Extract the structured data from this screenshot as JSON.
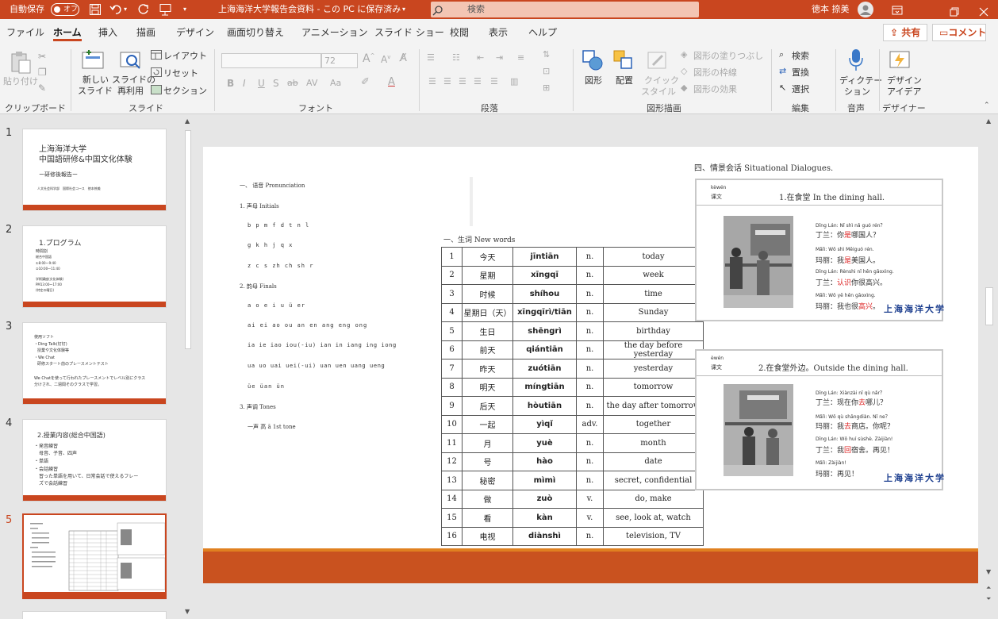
{
  "titlebar": {
    "autosave_label": "自動保存",
    "autosave_state": "オフ",
    "doc_title": "上海海洋大学報告会資料 - この PC に保存済み",
    "search_placeholder": "検索",
    "user_name": "徳本 捺美"
  },
  "tabs": [
    "ファイル",
    "ホーム",
    "挿入",
    "描画",
    "デザイン",
    "画面切り替え",
    "アニメーション",
    "スライド ショー",
    "校閲",
    "表示",
    "ヘルプ"
  ],
  "share_label": "共有",
  "comment_label": "コメント",
  "ribbon": {
    "paste": "貼り付け",
    "clipboard": "クリップボード",
    "new_slide_1": "新しい",
    "new_slide_2": "スライド",
    "reuse_1": "スライドの",
    "reuse_2": "再利用",
    "layout": "レイアウト",
    "reset": "リセット",
    "section": "セクション",
    "slides_group": "スライド",
    "font_size": "72",
    "font_group": "フォント",
    "paragraph_group": "段落",
    "shape": "図形",
    "arrange": "配置",
    "quick_1": "クイック",
    "quick_2": "スタイル",
    "fill": "図形の塗りつぶし",
    "outline": "図形の枠線",
    "effect": "図形の効果",
    "drawing_group": "図形描画",
    "find": "検索",
    "replace": "置換",
    "select": "選択",
    "editing_group": "編集",
    "dictate_1": "ディクテー",
    "dictate_2": "ション",
    "voice_group": "音声",
    "designer_1": "デザイン",
    "designer_2": "アイデア",
    "designer_group": "デザイナー"
  },
  "thumbnails": [
    {
      "num": "1",
      "title1": "上海海洋大学",
      "title2": "中国語研修&中国文化体験",
      "sub": "ー研修後報告ー",
      "foot": "人文社会科学部　国際社会コース　徳本捺美"
    },
    {
      "num": "2",
      "title": "1.プログラム",
      "l1": "時間割",
      "l2": "総合中国語",
      "l3": "①8:00〜9:40",
      "l4": "②10:00〜11:40",
      "l5": "学術講座(文化体験)",
      "l6": "PM13:00〜17:00",
      "l7": "(特定の曜日)"
    },
    {
      "num": "3",
      "l1": "使用ソフト",
      "l2": "・Ding Talk(钉钉)",
      "l3": "授業や文化体験等",
      "l4": "・We Chat",
      "l5": "研修スタート前のプレースメントテスト",
      "l6": "We Chatを使って行われたプレースメントでレベル別にクラス",
      "l7": "分けされ、二週間そのクラスで学習。"
    },
    {
      "num": "4",
      "title": "2.授業内容(総合中国語)",
      "l1": "・発音練習",
      "l2": "母音、子音、四声",
      "l3": "・単語",
      "l4": "・会話練習",
      "l5": "習った単語を用いて、日常会話で使えるフレー",
      "l6": "ズで会話練習"
    },
    {
      "num": "5"
    }
  ],
  "slide": {
    "pron_title": "一、 语音 Pronunciation",
    "initials_title": "1. 声母 Initials",
    "initials": [
      "b p m f d t n l",
      "g k h    j q x",
      "z c s    zh ch sh r"
    ],
    "finals_title": "2. 韵母 Finals",
    "finals": [
      "a    o    e      i      u    ü    er",
      "ai  ei  ao    ou    an  en  ang  eng  ong",
      "ia   ie  iao  iou(-iu)  ian  in  iang  ing  iong",
      "ua   uo   uai  uei(-ui)  uan  uen  uang  ueng",
      "üe  üan  ün"
    ],
    "tones_title": "3. 声调 Tones",
    "tones_line": "一声  高    ā  1st tone",
    "new_words_title": "一、生词 New words",
    "vocab": [
      [
        "1",
        "今天",
        "jīntiān",
        "n.",
        "today"
      ],
      [
        "2",
        "星期",
        "xīngqī",
        "n.",
        "week"
      ],
      [
        "3",
        "时候",
        "shíhou",
        "n.",
        "time"
      ],
      [
        "4",
        "星期日（天）",
        "xīngqīrì/tiān",
        "n.",
        "Sunday"
      ],
      [
        "5",
        "生日",
        "shēngrì",
        "n.",
        "birthday"
      ],
      [
        "6",
        "前天",
        "qiántiān",
        "n.",
        "the day before yesterday"
      ],
      [
        "7",
        "昨天",
        "zuótiān",
        "n.",
        "yesterday"
      ],
      [
        "8",
        "明天",
        "míngtiān",
        "n.",
        "tomorrow"
      ],
      [
        "9",
        "后天",
        "hòutiān",
        "n.",
        "the day after tomorrow"
      ],
      [
        "10",
        "一起",
        "yìqǐ",
        "adv.",
        "together"
      ],
      [
        "11",
        "月",
        "yuè",
        "n.",
        "month"
      ],
      [
        "12",
        "号",
        "hào",
        "n.",
        "date"
      ],
      [
        "13",
        "秘密",
        "mìmì",
        "n.",
        "secret, confidential"
      ],
      [
        "14",
        "做",
        "zuò",
        "v.",
        "do, make"
      ],
      [
        "15",
        "看",
        "kàn",
        "v.",
        "see, look at, watch"
      ],
      [
        "16",
        "电视",
        "diànshì",
        "n.",
        "television, TV"
      ]
    ],
    "dialog_title": "四、情景会话 Situational Dialogues.",
    "card1": {
      "kewen_py": "kèwén",
      "kewen": "课文",
      "title": "1.在食堂 In the dining hall.",
      "lines": [
        {
          "py": "Dīng Lán: Nǐ shì nǎ guó rén？",
          "zh_a": "丁兰：你",
          "zh_h": "是",
          "zh_b": "哪国人？"
        },
        {
          "py": "Mǎlì:   Wǒ shì Měiguó rén.",
          "zh_a": "玛丽：我",
          "zh_h": "是",
          "zh_b": "美国人。"
        },
        {
          "py": "Dīng Lán: Rènshi nǐ hěn gāoxìng.",
          "zh_a": "丁兰：",
          "zh_h": "认识",
          "zh_b": "你很高兴。"
        },
        {
          "py": "Mǎlì:   Wǒ yě hěn gāoxìng.",
          "zh_a": "玛丽：我也很",
          "zh_h": "高兴",
          "zh_b": "。"
        }
      ],
      "logo": "上海海洋大学"
    },
    "card2": {
      "kewen_py": "èwén",
      "kewen": "课文",
      "title": "2.在食堂外边。Outside the dining hall.",
      "lines": [
        {
          "py": "Dīng Lán: Xiànzài nǐ qù nǎr？",
          "zh_a": "丁兰：现在你",
          "zh_h": "去",
          "zh_b": "哪儿？"
        },
        {
          "py": "Mǎlì:   Wǒ qù shāngdiàn. Nǐ ne？",
          "zh_a": "玛丽：我",
          "zh_h": "去",
          "zh_b": "商店。你呢？"
        },
        {
          "py": "Dīng Lán: Wǒ huí sùshè. Zàijiàn!",
          "zh_a": "丁兰：我",
          "zh_h": "回",
          "zh_b": "宿舍。再见！"
        },
        {
          "py": "Mǎlì:   Zàijiàn!",
          "zh_a": "玛丽：再见！",
          "zh_h": "",
          "zh_b": ""
        }
      ],
      "logo": "上海海洋大学"
    }
  }
}
